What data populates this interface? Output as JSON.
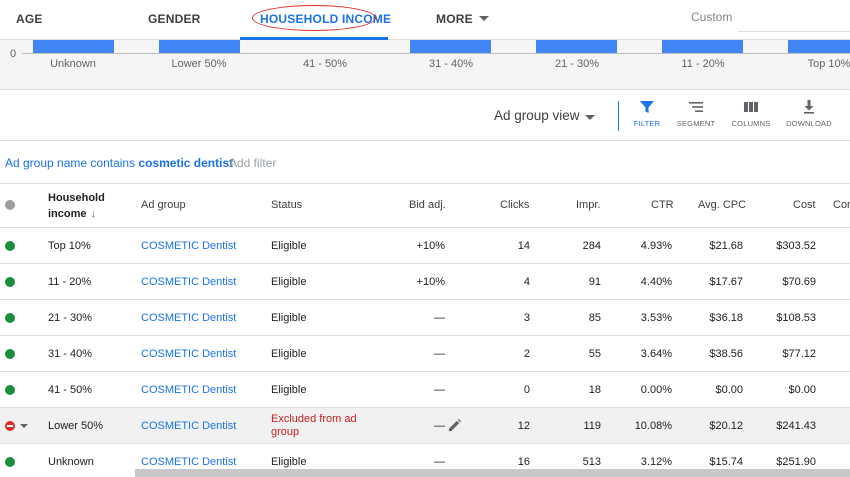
{
  "tabs": {
    "age": "AGE",
    "gender": "GENDER",
    "household_income": "HOUSEHOLD INCOME",
    "more": "MORE",
    "custom_placeholder": "Custom"
  },
  "chart_data": {
    "type": "bar",
    "categories": [
      "Unknown",
      "Lower 50%",
      "41 - 50%",
      "31 - 40%",
      "21 - 30%",
      "11 - 20%",
      "Top 10%"
    ],
    "y_tick_labels": [
      "0"
    ],
    "bar_color": "#4285f4",
    "background_color": "#f5f5f5"
  },
  "toolbar": {
    "view_label": "Ad group view",
    "filter": "FILTER",
    "segment": "SEGMENT",
    "columns": "COLUMNS",
    "download": "DOWNLOAD"
  },
  "filter_bar": {
    "prefix": "Ad group name contains ",
    "value": "cosmetic dentist",
    "add_filter": "Add filter"
  },
  "table": {
    "headers": {
      "household_income_line1": "Household",
      "household_income_line2": "income",
      "sort_arrow": "↓",
      "ad_group": "Ad group",
      "status": "Status",
      "bid_adj": "Bid adj.",
      "clicks": "Clicks",
      "impr": "Impr.",
      "ctr": "CTR",
      "avg_cpc": "Avg. CPC",
      "cost": "Cost",
      "conv": "Con"
    },
    "rows": [
      {
        "income": "Top 10%",
        "ad_group": "COSMETIC Dentist",
        "status": "Eligible",
        "bid_adj": "+10%",
        "clicks": "14",
        "impr": "284",
        "ctr": "4.93%",
        "avg_cpc": "$21.68",
        "cost": "$303.52"
      },
      {
        "income": "11 - 20%",
        "ad_group": "COSMETIC Dentist",
        "status": "Eligible",
        "bid_adj": "+10%",
        "clicks": "4",
        "impr": "91",
        "ctr": "4.40%",
        "avg_cpc": "$17.67",
        "cost": "$70.69"
      },
      {
        "income": "21 - 30%",
        "ad_group": "COSMETIC Dentist",
        "status": "Eligible",
        "bid_adj": "—",
        "clicks": "3",
        "impr": "85",
        "ctr": "3.53%",
        "avg_cpc": "$36.18",
        "cost": "$108.53"
      },
      {
        "income": "31 - 40%",
        "ad_group": "COSMETIC Dentist",
        "status": "Eligible",
        "bid_adj": "—",
        "clicks": "2",
        "impr": "55",
        "ctr": "3.64%",
        "avg_cpc": "$38.56",
        "cost": "$77.12"
      },
      {
        "income": "41 - 50%",
        "ad_group": "COSMETIC Dentist",
        "status": "Eligible",
        "bid_adj": "—",
        "clicks": "0",
        "impr": "18",
        "ctr": "0.00%",
        "avg_cpc": "$0.00",
        "cost": "$0.00"
      },
      {
        "income": "Lower 50%",
        "ad_group": "COSMETIC Dentist",
        "status": "Excluded from ad group",
        "bid_adj": "—",
        "clicks": "12",
        "impr": "119",
        "ctr": "10.08%",
        "avg_cpc": "$20.12",
        "cost": "$241.43"
      },
      {
        "income": "Unknown",
        "ad_group": "COSMETIC Dentist",
        "status": "Eligible",
        "bid_adj": "—",
        "clicks": "16",
        "impr": "513",
        "ctr": "3.12%",
        "avg_cpc": "$15.74",
        "cost": "$251.90"
      }
    ]
  },
  "colors": {
    "accent": "#1a73e8",
    "eligible_dot": "#1e8e3e",
    "excluded_dot": "#d93025",
    "excluded_text": "#c5221f",
    "highlight_oval": "#d93025"
  }
}
